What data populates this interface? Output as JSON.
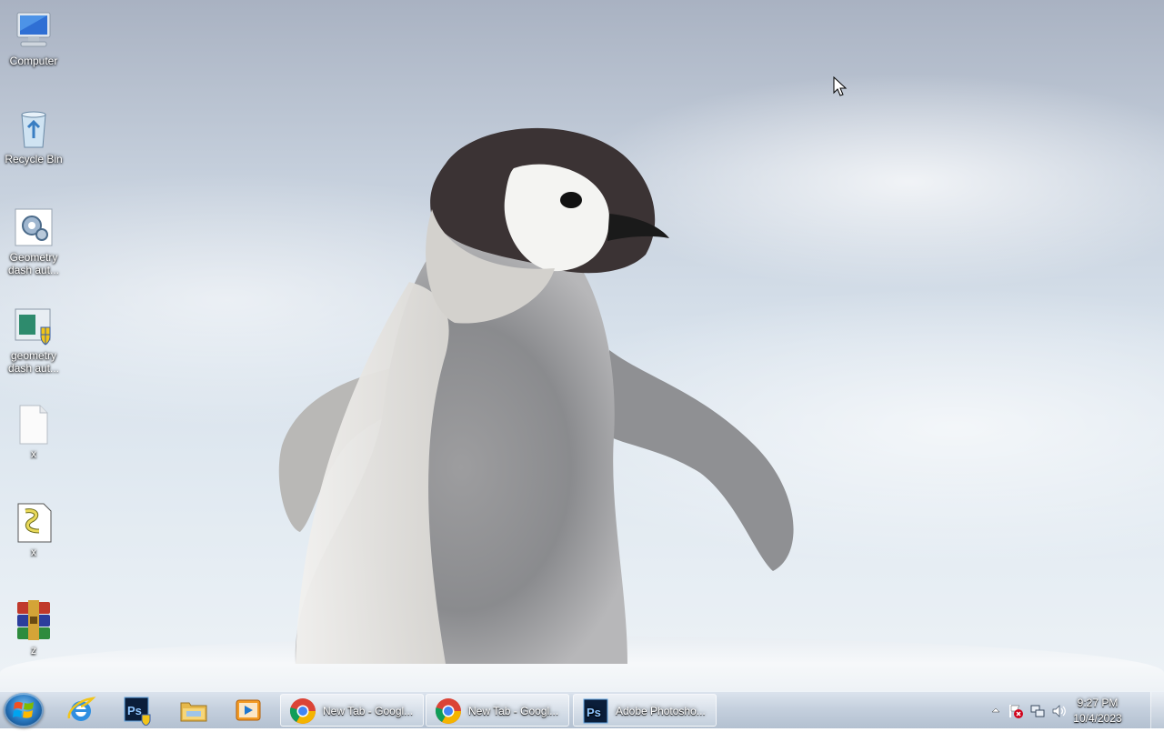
{
  "desktop": {
    "icons": [
      {
        "name": "computer-icon",
        "label": "Computer"
      },
      {
        "name": "recycle-bin-icon",
        "label": "Recycle Bin"
      },
      {
        "name": "gear-shortcut-icon",
        "label": "Geometry dash aut..."
      },
      {
        "name": "installer-shield-icon",
        "label": "geometry dash aut..."
      },
      {
        "name": "blank-file-icon",
        "label": "x"
      },
      {
        "name": "script-file-icon",
        "label": "x"
      },
      {
        "name": "winrar-archive-icon",
        "label": "z"
      }
    ]
  },
  "taskbar": {
    "pinned": [
      {
        "name": "internet-explorer-icon"
      },
      {
        "name": "photoshop-icon"
      },
      {
        "name": "file-explorer-icon"
      },
      {
        "name": "media-player-icon"
      }
    ],
    "windows": [
      {
        "name": "chrome-icon",
        "label": "New Tab - Googl..."
      },
      {
        "name": "chrome-icon",
        "label": "New Tab - Googl..."
      },
      {
        "name": "photoshop-icon",
        "label": "Adobe Photosho..."
      }
    ],
    "tray": {
      "icons": [
        "show-hidden-icons-icon",
        "action-center-flag-icon",
        "network-icon",
        "volume-icon"
      ],
      "time": "9:27 PM",
      "date": "10/4/2023"
    }
  }
}
